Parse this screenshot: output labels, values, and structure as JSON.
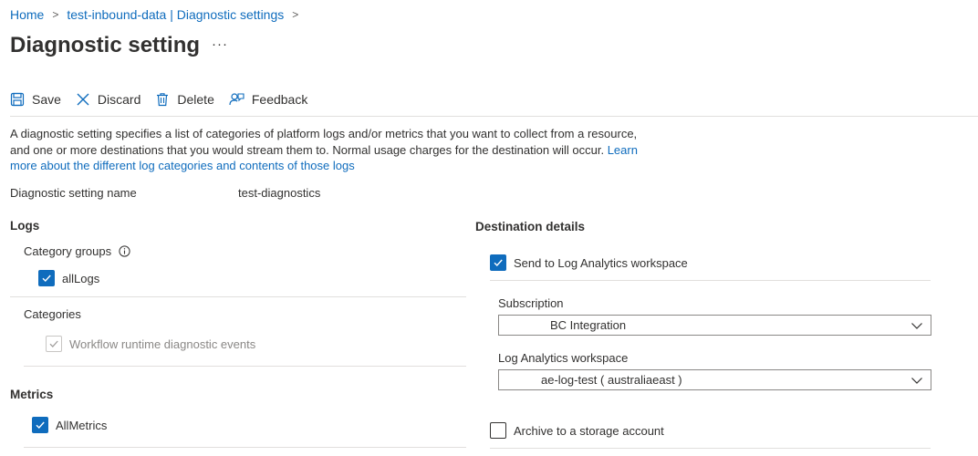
{
  "breadcrumb": {
    "home": "Home",
    "parent": "test-inbound-data | Diagnostic settings",
    "sep": ">"
  },
  "page": {
    "title": "Diagnostic setting",
    "more": "···"
  },
  "toolbar": {
    "save": "Save",
    "discard": "Discard",
    "delete": "Delete",
    "feedback": "Feedback"
  },
  "description": {
    "text": "A diagnostic setting specifies a list of categories of platform logs and/or metrics that you want to collect from a resource, and one or more destinations that you would stream them to. Normal usage charges for the destination will occur. ",
    "link_first": "Learn",
    "link_rest": "more about the different log categories and contents of those logs"
  },
  "setting": {
    "name_label": "Diagnostic setting name",
    "name_value": "test-diagnostics"
  },
  "logs": {
    "title": "Logs",
    "category_groups_label": "Category groups",
    "all_logs": {
      "label": "allLogs",
      "checked": true
    },
    "categories_label": "Categories",
    "workflow": {
      "label": "Workflow runtime diagnostic events",
      "checked": true,
      "disabled": true
    }
  },
  "metrics": {
    "title": "Metrics",
    "all_metrics": {
      "label": "AllMetrics",
      "checked": true
    }
  },
  "destination": {
    "title": "Destination details",
    "log_analytics": {
      "label": "Send to Log Analytics workspace",
      "checked": true
    },
    "subscription_label": "Subscription",
    "subscription_value": "BC Integration",
    "workspace_label": "Log Analytics workspace",
    "workspace_value": "ae-log-test ( australiaeast )",
    "archive": {
      "label": "Archive to a storage account",
      "checked": false
    }
  },
  "colors": {
    "accent": "#0f6cbd",
    "text": "#323130",
    "border": "#8a8886",
    "divider": "#e1dfdd",
    "disabled": "#c8c6c4"
  }
}
